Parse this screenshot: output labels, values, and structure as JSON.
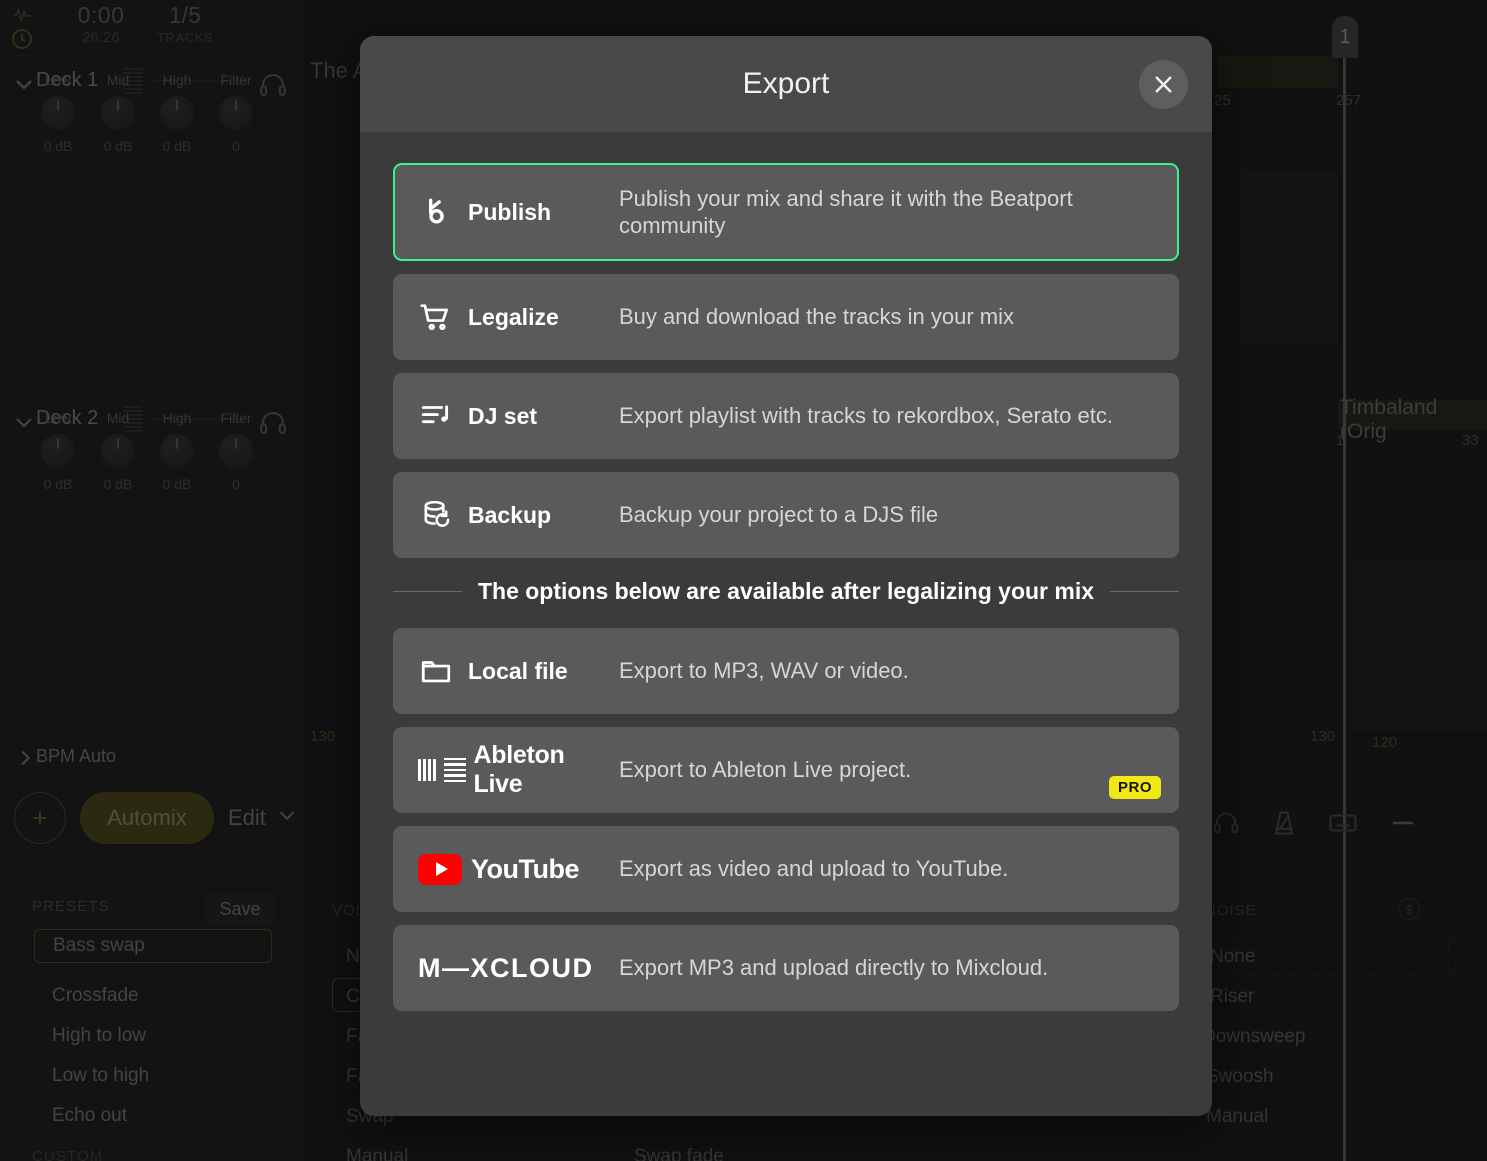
{
  "background": {
    "transport": {
      "elapsed": "0:00",
      "total": "26:26",
      "track_position": "1/5",
      "tracks_label": "TRACKS",
      "wave_icon": "waveform-icon",
      "clock_icon": "clock-icon"
    },
    "decks": [
      {
        "name": "Deck 1",
        "headphones_icon": "headphones-icon",
        "knobs": [
          {
            "label": "Low",
            "value": "0 dB"
          },
          {
            "label": "Mid",
            "value": "0 dB"
          },
          {
            "label": "High",
            "value": "0 dB"
          },
          {
            "label": "Filter",
            "value": "0"
          }
        ]
      },
      {
        "name": "Deck 2",
        "headphones_icon": "headphones-icon",
        "knobs": [
          {
            "label": "Low",
            "value": "0 dB"
          },
          {
            "label": "Mid",
            "value": "0 dB"
          },
          {
            "label": "High",
            "value": "0 dB"
          },
          {
            "label": "Filter",
            "value": "0"
          }
        ]
      }
    ],
    "bpm": {
      "label": "BPM Auto",
      "chevron_icon": "chevron-right-icon"
    },
    "actions": {
      "add_label": "+",
      "automix_label": "Automix",
      "edit_label": "Edit",
      "edit_chevron": "chevron-down-icon"
    },
    "presets": {
      "header": "PRESETS",
      "save_label": "Save",
      "items": [
        "Bass swap",
        "Crossfade",
        "High to low",
        "Low to high",
        "Echo out"
      ],
      "selected": "Bass swap",
      "custom_header": "CUSTOM"
    },
    "middle_column": {
      "header": "VOLUME",
      "items": [
        "None",
        "Crossfade",
        "Fade out",
        "Fade in",
        "Swap",
        "Manual"
      ],
      "selected": "Crossfade",
      "bottom_label": "Swap fade"
    },
    "noise_column": {
      "header": "NOISE",
      "items": [
        "None",
        "Riser",
        "Downsweep",
        "Swoosh",
        "Manual"
      ],
      "price_icon": "dollar-icon"
    },
    "timeline": {
      "left_track_title": "The A",
      "right_track_title": "Timbaland (Orig",
      "playhead_marker": "1",
      "ticks": [
        "130",
        "120",
        "25",
        "257",
        "1",
        "33",
        "130"
      ]
    },
    "toolbar_icons": [
      "headphones-icon",
      "metronome-icon",
      "keyboard-icon",
      "minus-icon"
    ]
  },
  "modal": {
    "title": "Export",
    "close_icon": "close-icon",
    "highlight_color": "#3ff08e",
    "pro_badge_color": "#f2e815",
    "divider_text": "The options below are available after legalizing your mix",
    "primary_options": [
      {
        "id": "publish",
        "label": "Publish",
        "description": "Publish your mix and share it with the Beatport community",
        "icon": "beatport-logo-icon",
        "highlighted": true
      },
      {
        "id": "legalize",
        "label": "Legalize",
        "description": "Buy and download the tracks in your mix",
        "icon": "shopping-cart-icon",
        "highlighted": false
      },
      {
        "id": "dj-set",
        "label": "DJ set",
        "description": "Export playlist with tracks to rekordbox, Serato etc.",
        "icon": "playlist-note-icon",
        "highlighted": false
      },
      {
        "id": "backup",
        "label": "Backup",
        "description": "Backup your project to a DJS file",
        "icon": "database-restore-icon",
        "highlighted": false
      }
    ],
    "locked_options": [
      {
        "id": "local-file",
        "label": "Local file",
        "description": "Export to MP3, WAV or video.",
        "icon": "folder-icon",
        "badge": ""
      },
      {
        "id": "ableton-live",
        "label": "Ableton Live",
        "description": "Export to Ableton Live project.",
        "icon": "ableton-live-logo-icon",
        "badge": "PRO"
      },
      {
        "id": "youtube",
        "label": "YouTube",
        "description": "Export as video and upload to YouTube.",
        "icon": "youtube-logo-icon",
        "badge": ""
      },
      {
        "id": "mixcloud",
        "label": "M—XCLOUD",
        "description": "Export MP3 and upload directly to Mixcloud.",
        "icon": "mixcloud-logo-icon",
        "badge": ""
      }
    ]
  }
}
